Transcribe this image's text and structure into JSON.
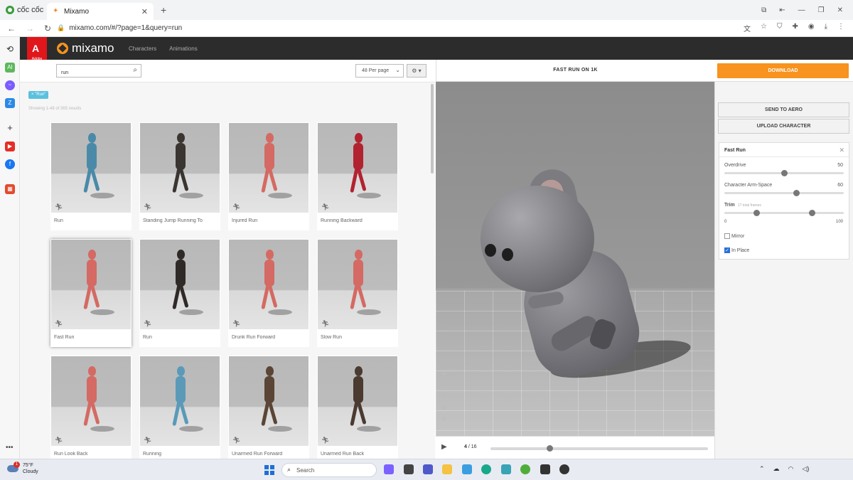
{
  "browser": {
    "brand": "cốc cốc",
    "tab_title": "Mixamo",
    "url": "mixamo.com/#/?page=1&query=run"
  },
  "adobe": {
    "label": "Adobe"
  },
  "app": {
    "name": "mixamo",
    "nav": [
      "Characters",
      "Animations"
    ]
  },
  "search": {
    "value": "run"
  },
  "toolbar": {
    "per_page": "48 Per page"
  },
  "filter_tag": "× \"Run\"",
  "results_text": "Showing 1-48 of 365 results",
  "animations": [
    {
      "label": "Run",
      "color": "#4a8aa8"
    },
    {
      "label": "Standing Jump Running To",
      "color": "#3a3530"
    },
    {
      "label": "Injured Run",
      "color": "#d46a63"
    },
    {
      "label": "Running Backward",
      "color": "#b22330"
    },
    {
      "label": "Fast Run",
      "color": "#d46a63"
    },
    {
      "label": "Run",
      "color": "#2f2a28"
    },
    {
      "label": "Drunk Run Forward",
      "color": "#d46a63"
    },
    {
      "label": "Slow Run",
      "color": "#d46a63"
    },
    {
      "label": "Run Look Back",
      "color": "#d46a63"
    },
    {
      "label": "Running",
      "color": "#5a9ab8"
    },
    {
      "label": "Unarmed Run Forward",
      "color": "#5a4536"
    },
    {
      "label": "Unarmed Run Back",
      "color": "#4a3a30"
    }
  ],
  "selected_index": 4,
  "preview": {
    "title": "FAST RUN ON 1K",
    "frame_current": "4",
    "frame_total": "/ 16",
    "progress": 0.27
  },
  "actions": {
    "download": "DOWNLOAD",
    "send": "SEND TO AERO",
    "upload": "UPLOAD CHARACTER"
  },
  "settings": {
    "title": "Fast Run",
    "overdrive_label": "Overdrive",
    "overdrive_value": "50",
    "overdrive": 0.5,
    "armspace_label": "Character Arm-Space",
    "armspace_value": "60",
    "armspace": 0.6,
    "trim_label": "Trim",
    "trim_sub": "17 total frames",
    "trim_min": "0",
    "trim_max": "100",
    "trim_start": 0.27,
    "trim_end": 0.73,
    "mirror_label": "Mirror",
    "mirror": false,
    "inplace_label": "In Place",
    "inplace": true
  },
  "taskbar": {
    "temp": "75°F",
    "condition": "Cloudy",
    "notif": "1",
    "search_placeholder": "Search"
  }
}
